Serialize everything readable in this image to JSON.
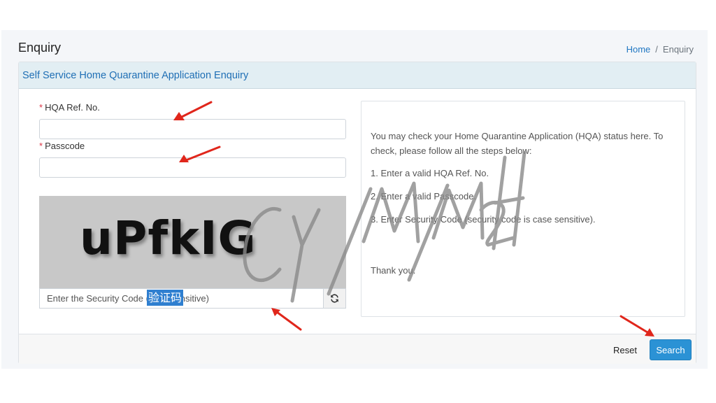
{
  "header": {
    "title": "Enquiry",
    "breadcrumb": {
      "home": "Home",
      "separator": "/",
      "current": "Enquiry"
    }
  },
  "card": {
    "title": "Self Service Home Quarantine Application Enquiry"
  },
  "form": {
    "required_marker": "*",
    "ref_no": {
      "label": "HQA Ref. No.",
      "value": ""
    },
    "passcode": {
      "label": "Passcode",
      "value": ""
    },
    "captcha": {
      "image_text": "uPfkIG",
      "placeholder": "Enter the Security Code (case sensitive)",
      "refresh_icon": "refresh-icon"
    }
  },
  "overlay": {
    "cn_label": "验证码",
    "watermark": "CY/M/M2H"
  },
  "info": {
    "intro": "You may check your Home Quarantine Application (HQA) status here. To check, please follow all the steps below:",
    "steps": [
      "1. Enter a valid HQA Ref. No.",
      "2. Enter a valid Passcode.",
      "3. Enter Security Code (security code is case sensitive)."
    ],
    "closing": "Thank you."
  },
  "footer": {
    "reset_label": "Reset",
    "search_label": "Search"
  },
  "colors": {
    "accent": "#2b92d5",
    "header_bg": "#e2eef3",
    "title_blue": "#1f6fb5",
    "arrow_red": "#e0261b",
    "required": "#dc3545"
  }
}
